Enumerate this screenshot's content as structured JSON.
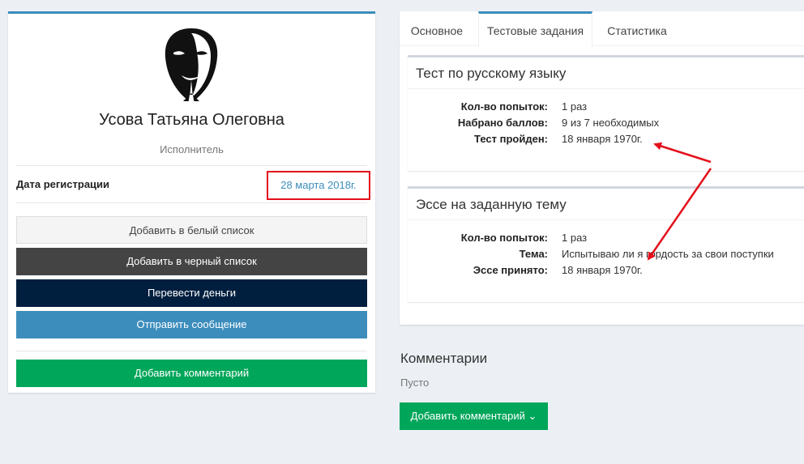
{
  "profile": {
    "name": "Усова Татьяна Олеговна",
    "role": "Исполнитель",
    "registration_label": "Дата регистрации",
    "registration_date": "28 марта 2018г.",
    "buttons": {
      "whitelist": "Добавить в белый список",
      "blacklist": "Добавить в черный список",
      "transfer": "Перевести деньги",
      "message": "Отправить сообщение",
      "comment": "Добавить комментарий"
    }
  },
  "tabs": [
    "Основное",
    "Тестовые задания",
    "Статистика"
  ],
  "tasks": [
    {
      "title": "Тест по русскому языку",
      "rows": [
        {
          "label": "Кол-во попыток:",
          "value": "1 раз"
        },
        {
          "label": "Набрано баллов:",
          "value": "9 из 7 необходимых"
        },
        {
          "label": "Тест пройден:",
          "value": "18 января 1970г."
        }
      ]
    },
    {
      "title": "Эссе на заданную тему",
      "rows": [
        {
          "label": "Кол-во попыток:",
          "value": "1 раз"
        },
        {
          "label": "Тема:",
          "value": "Испытываю ли я гордость за свои поступки"
        },
        {
          "label": "Эссе принято:",
          "value": "18 января 1970г."
        }
      ]
    }
  ],
  "comments": {
    "title": "Комментарии",
    "empty": "Пусто",
    "add_button": "Добавить комментарий ⌄"
  },
  "colors": {
    "accent_blue": "#3c8dbc",
    "green": "#00a65a",
    "navy": "#001f3f",
    "dark": "#444444",
    "highlight_red": "#e4101b"
  },
  "icons": {
    "avatar": "guy-fawkes-mask-avatar",
    "annotation": "red-arrow"
  }
}
